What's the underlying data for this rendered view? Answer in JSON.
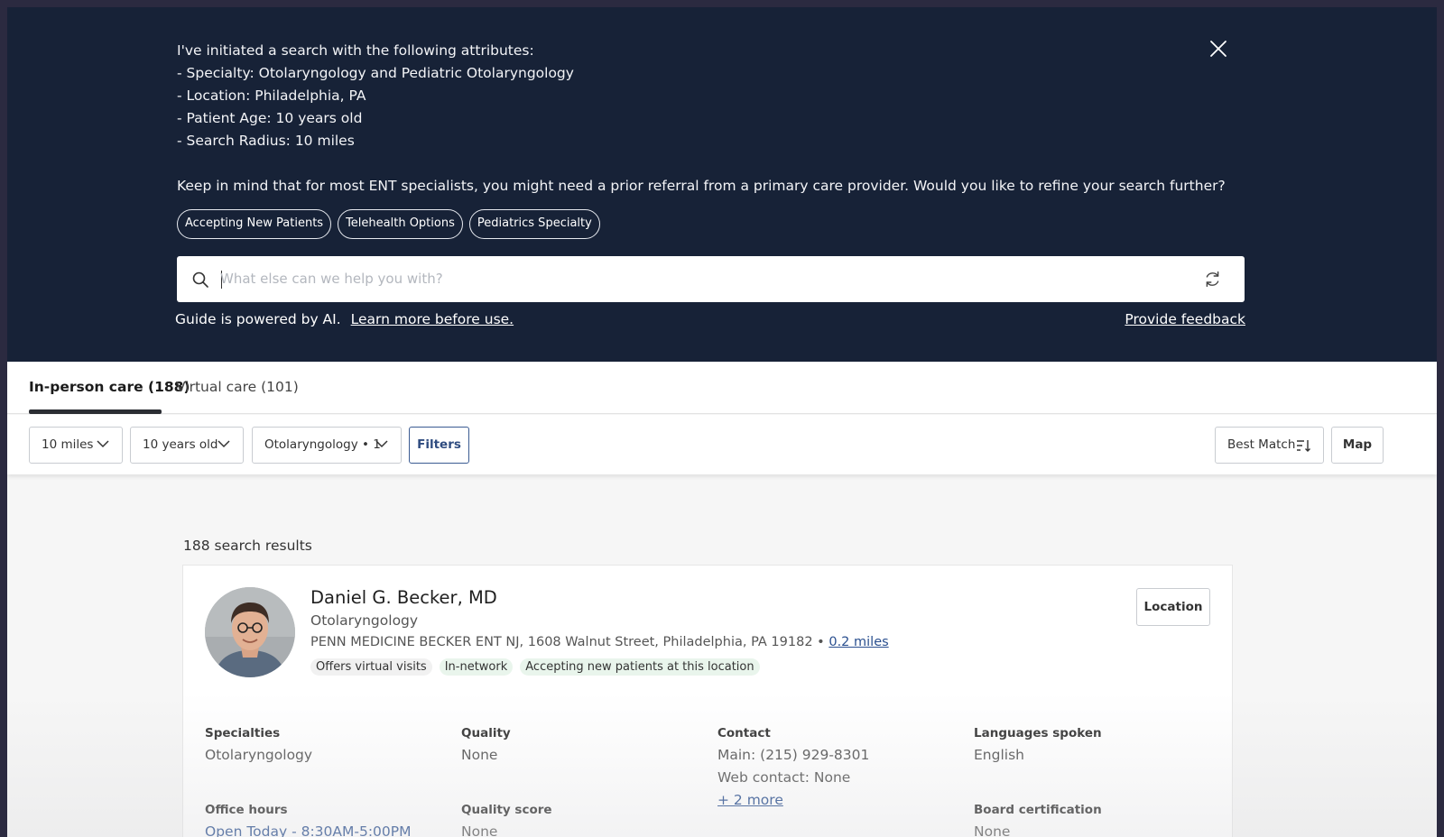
{
  "guide": {
    "intro": "I've initiated a search with the following attributes:",
    "attributes": [
      "- Specialty: Otolaryngology and Pediatric Otolaryngology",
      "- Location: Philadelphia, PA",
      "- Patient Age: 10 years old",
      "- Search Radius: 10 miles"
    ],
    "followup": "Keep in mind that for most ENT specialists, you might need a prior referral from a primary care provider. Would you like to refine your search further?",
    "chips": [
      "Accepting New Patients",
      "Telehealth Options",
      "Pediatrics Specialty"
    ],
    "search_placeholder": "What else can we help you with?",
    "powered_text": "Guide is powered by AI.",
    "learn_more": "Learn more before use.",
    "feedback": "Provide feedback"
  },
  "tabs": [
    {
      "label": "In-person care (188)",
      "active": true
    },
    {
      "label": "Virtual care (101)",
      "active": false
    }
  ],
  "filters": {
    "distance": "10 miles",
    "age": "10 years old",
    "specialty": "Otolaryngology • 1",
    "filters_label": "Filters",
    "sort": "Best Match",
    "map": "Map"
  },
  "results": {
    "count_text": "188 search results",
    "provider": {
      "name": "Daniel G. Becker, MD",
      "specialty": "Otolaryngology",
      "address": "PENN MEDICINE BECKER ENT NJ, 1608 Walnut Street, Philadelphia, PA 19182",
      "distance": "0.2 miles",
      "tags": [
        "Offers virtual visits",
        "In-network",
        "Accepting new patients at this location"
      ],
      "location_button": "Location",
      "specialties_label": "Specialties",
      "specialties_value": "Otolaryngology",
      "office_hours_label": "Office hours",
      "office_hours_value": "Open Today - 8:30AM-5:00PM",
      "quality_label": "Quality",
      "quality_value": "None",
      "quality_score_label": "Quality score",
      "quality_score_value": "None",
      "contact_label": "Contact",
      "contact_main": "Main: (215) 929-8301",
      "contact_web": "Web contact: None",
      "contact_more": "+ 2 more",
      "languages_label": "Languages spoken",
      "languages_value": "English",
      "board_label": "Board certification",
      "board_value": "None"
    }
  },
  "colors": {
    "guide_bg": "#172237",
    "link": "#2a4f8f",
    "filters_accent": "#3b5b92",
    "tag_green": "#e9f5ec"
  },
  "icons": [
    "close-icon",
    "search-icon",
    "refresh-icon",
    "chevron-down-icon",
    "sort-icon"
  ]
}
